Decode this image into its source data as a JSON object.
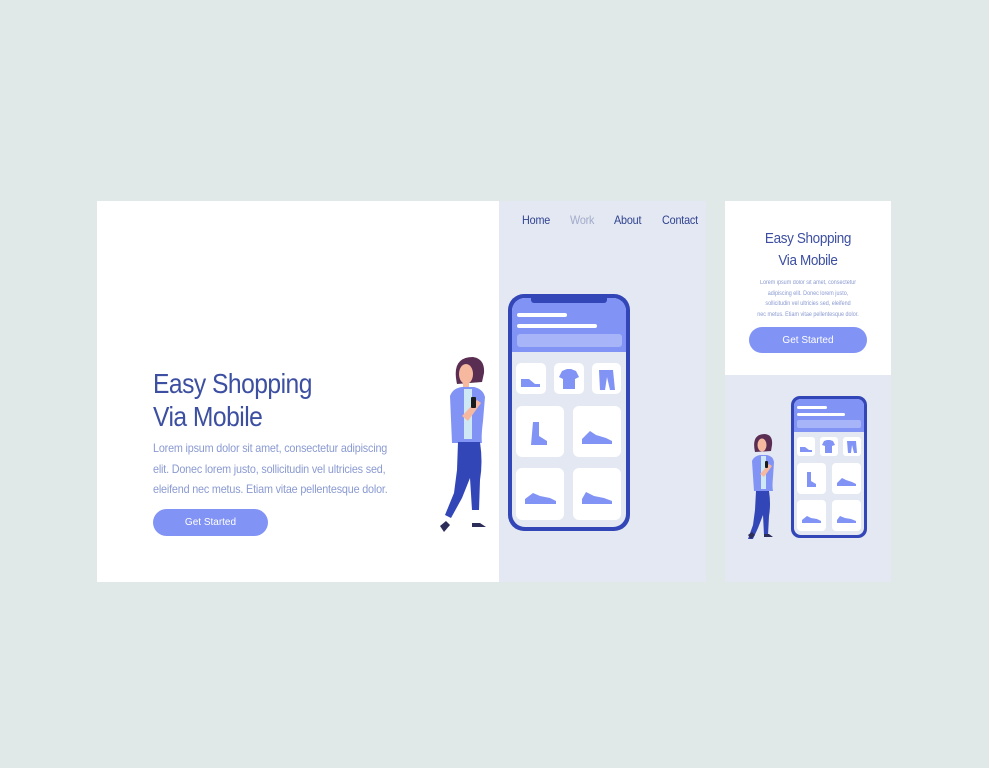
{
  "desktop": {
    "nav": [
      "Home",
      "Work",
      "About",
      "Contact"
    ],
    "title_line1": "Easy Shopping",
    "title_line2": "Via Mobile",
    "body_lines": [
      "Lorem ipsum dolor sit amet, consectetur  adipiscing",
      "elit. Donec lorem justo, sollicitudin vel ultricies sed,",
      "eleifend nec metus. Etiam vitae pellentesque dolor."
    ],
    "button": "Get Started"
  },
  "mobile": {
    "title_line1": "Easy Shopping",
    "title_line2": "Via Mobile",
    "body_lines": [
      "Lorem ipsum dolor sit amet, consectetur",
      "adipiscing elit. Donec lorem justo,",
      "sollicitudin vel ultricies sed, eleifend",
      "nec metus. Etiam vitae pellentesque dolor."
    ],
    "button": "Get Started"
  },
  "colors": {
    "page_bg": "#e1e8e8",
    "accent": "#8193f5",
    "title": "#3c4fa1",
    "body_text": "#8a9ad1",
    "phone_frame": "#3346b8",
    "panel_bg": "#e3e8f2"
  },
  "icons": [
    "woman-shopper-icon",
    "smartphone-icon",
    "shoe-icon",
    "tshirt-icon",
    "pants-icon",
    "boot-icon",
    "sneaker-icon"
  ]
}
